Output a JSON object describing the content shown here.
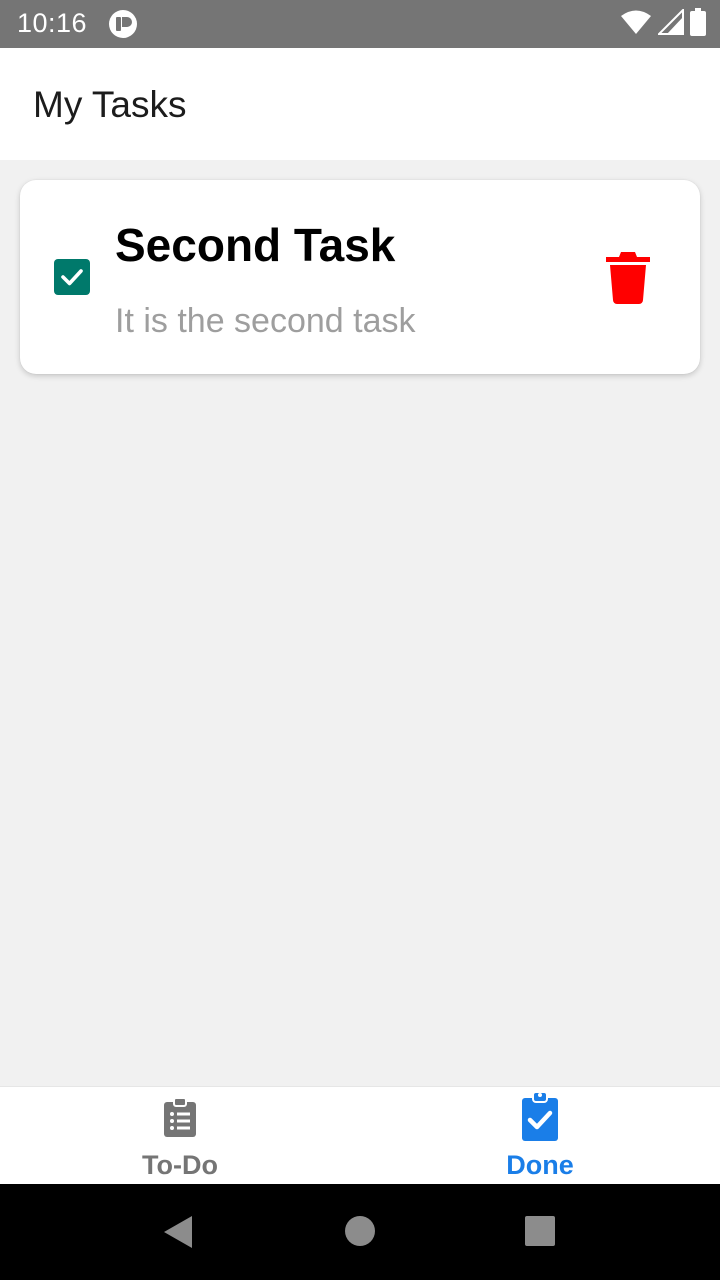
{
  "status_bar": {
    "time": "10:16",
    "app_icon": "notification-app-icon",
    "icons": [
      "wifi-icon",
      "cell-signal-icon",
      "battery-icon"
    ]
  },
  "header": {
    "title": "My Tasks"
  },
  "tasks": [
    {
      "title": "Second Task",
      "description": "It is the second task",
      "done": true,
      "checkbox_color": "#00796b",
      "delete_icon": "trash-icon",
      "delete_color": "#ff0000"
    }
  ],
  "bottom_nav": {
    "tabs": [
      {
        "label": "To-Do",
        "icon": "clipboard-list-icon",
        "active": false,
        "color": "#757575"
      },
      {
        "label": "Done",
        "icon": "clipboard-check-icon",
        "active": true,
        "color": "#1a7ee8"
      }
    ]
  },
  "system_nav": {
    "buttons": [
      "back-icon",
      "home-icon",
      "recents-icon"
    ]
  }
}
